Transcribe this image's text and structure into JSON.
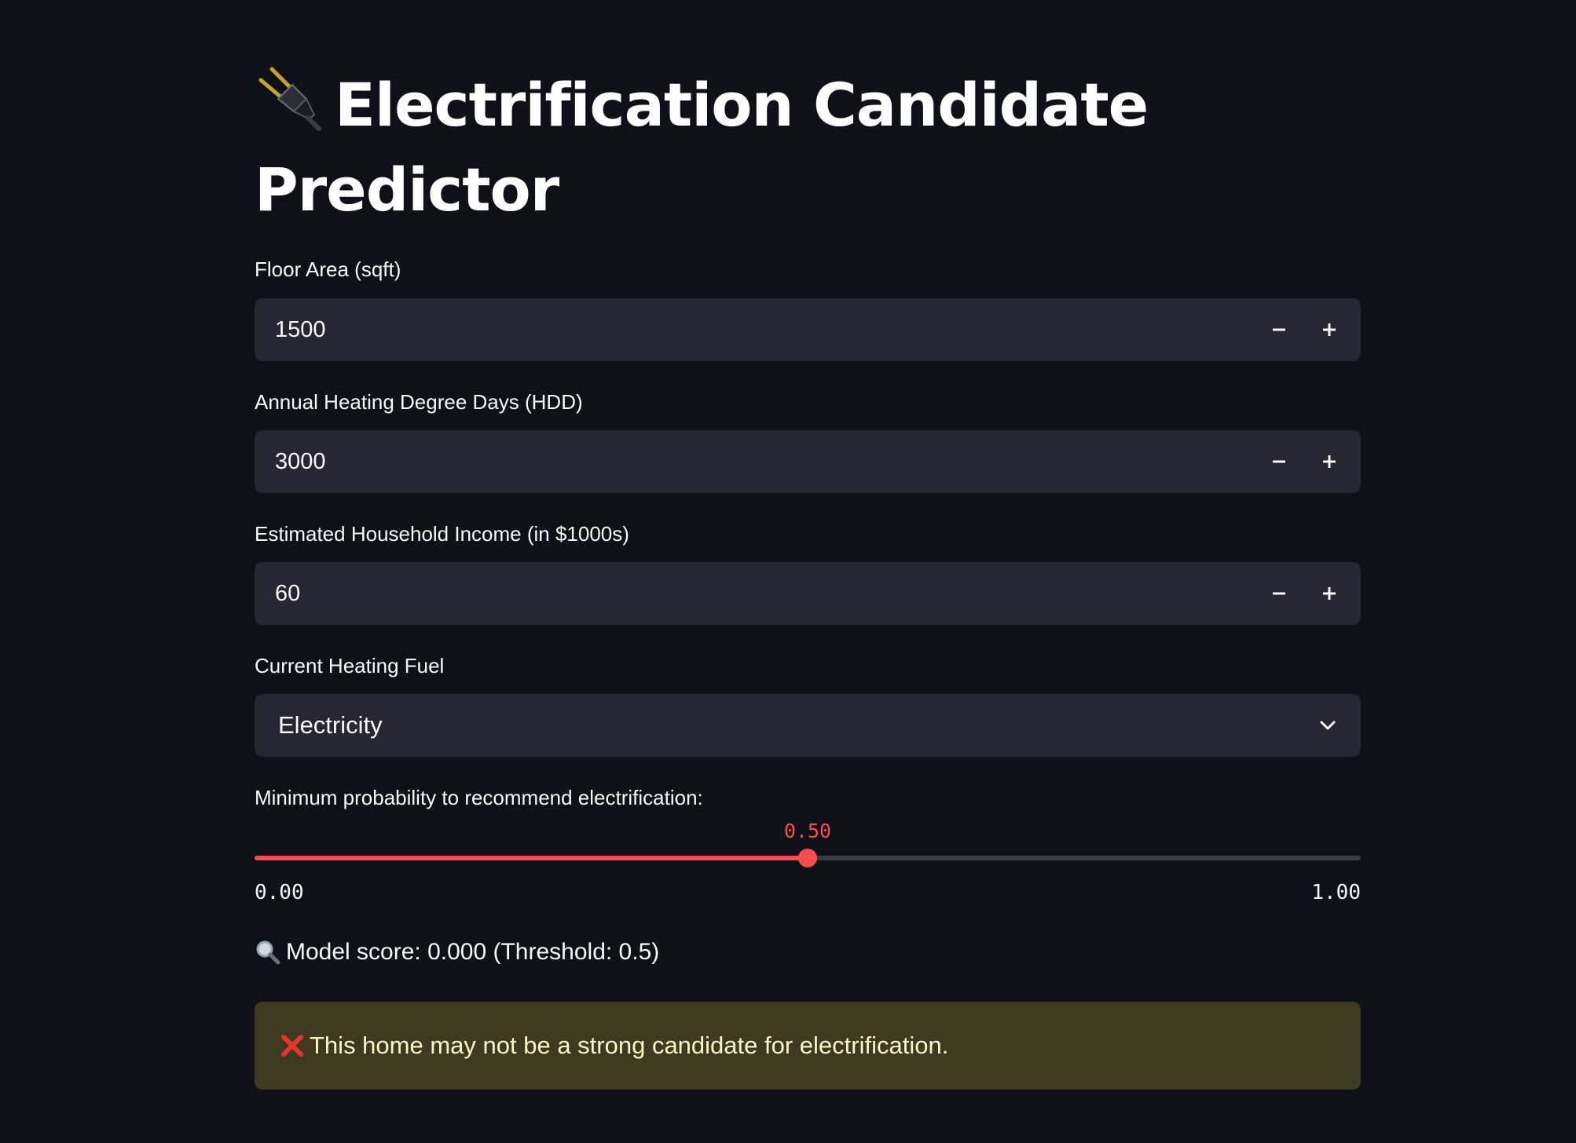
{
  "app": {
    "title": "Electrification Candidate Predictor",
    "title_icon": "electric-plug-icon"
  },
  "fields": {
    "floor_area": {
      "label": "Floor Area (sqft)",
      "value": "1500"
    },
    "hdd": {
      "label": "Annual Heating Degree Days (HDD)",
      "value": "3000"
    },
    "income": {
      "label": "Estimated Household Income (in $1000s)",
      "value": "60"
    },
    "heating_fuel": {
      "label": "Current Heating Fuel",
      "selected": "Electricity"
    }
  },
  "slider": {
    "label": "Minimum probability to recommend electrification:",
    "value": 0.5,
    "value_text": "0.50",
    "min_text": "0.00",
    "max_text": "1.00",
    "min": 0,
    "max": 1
  },
  "result": {
    "score_icon": "magnifying-glass-icon",
    "score_text": "Model score: 0.000 (Threshold: 0.5)",
    "alert_icon": "cross-mark-icon",
    "alert_text": "This home may not be a strong candidate for electrification."
  },
  "colors": {
    "background": "#0e1117",
    "input_bg": "#262730",
    "accent": "#ff4b4b",
    "warning_bg": "#3e3a22",
    "warning_text": "#fdf5c4"
  }
}
